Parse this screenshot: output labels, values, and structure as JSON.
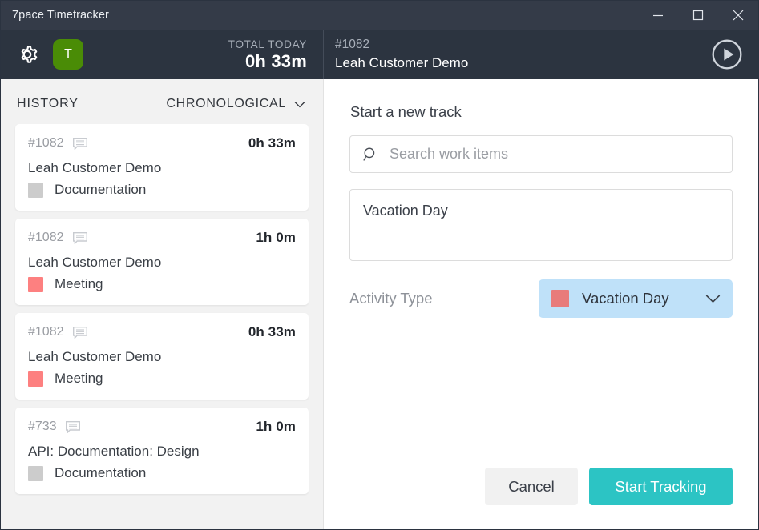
{
  "window": {
    "title": "7pace Timetracker",
    "controls": {
      "minimize": "minimize-icon",
      "maximize": "maximize-icon",
      "close": "close-icon"
    }
  },
  "header": {
    "settings_icon": "gear-icon",
    "avatar_initial": "T",
    "avatar_color": "#4a8c06",
    "total_label": "TOTAL TODAY",
    "total_value": "0h 33m",
    "current_item_id": "#1082",
    "current_item_title": "Leah Customer Demo",
    "play_icon": "play-circle-icon"
  },
  "history": {
    "title": "HISTORY",
    "sort_label": "CHRONOLOGICAL",
    "sort_caret": "chevron-down-icon",
    "entries": [
      {
        "id": "#1082",
        "comment_icon": "comment-icon",
        "duration": "0h 33m",
        "title": "Leah Customer Demo",
        "activity": "Documentation",
        "activity_color": "#cccccc"
      },
      {
        "id": "#1082",
        "comment_icon": "comment-icon",
        "duration": "1h 0m",
        "title": "Leah Customer Demo",
        "activity": "Meeting",
        "activity_color": "#fd8080"
      },
      {
        "id": "#1082",
        "comment_icon": "comment-icon",
        "duration": "0h 33m",
        "title": "Leah Customer Demo",
        "activity": "Meeting",
        "activity_color": "#fd8080"
      },
      {
        "id": "#733",
        "comment_icon": "comment-icon",
        "duration": "1h 0m",
        "title": "API: Documentation: Design",
        "activity": "Documentation",
        "activity_color": "#cccccc"
      }
    ]
  },
  "form": {
    "heading": "Start a new track",
    "search_icon": "search-icon",
    "search_placeholder": "Search work items",
    "search_value": "",
    "notes_value": "Vacation Day",
    "activity_label": "Activity Type",
    "activity_value": "Vacation Day",
    "activity_color": "#e87b7b",
    "activity_caret": "chevron-down-icon",
    "activity_bg": "#bfe1f9",
    "cancel_label": "Cancel",
    "start_label": "Start Tracking",
    "start_color": "#2cc4c4"
  }
}
